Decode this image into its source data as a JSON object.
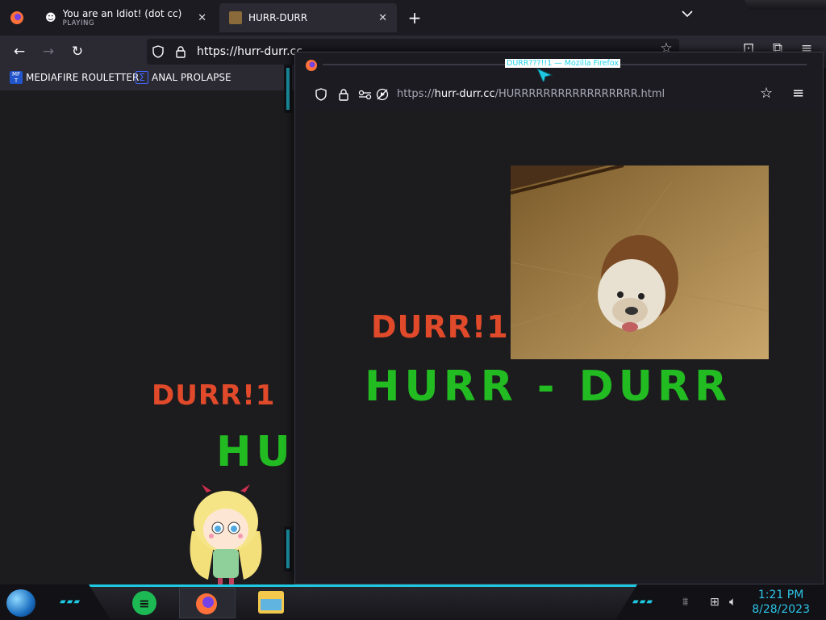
{
  "tabs": [
    {
      "title": "You are an Idiot! (dot cc)",
      "status": "PLAYING",
      "icon": "smiley-icon"
    },
    {
      "title": "HURR-DURR",
      "icon": "dog-icon"
    }
  ],
  "main_window": {
    "url": "https://hurr-durr.cc",
    "bookmarks": [
      {
        "label": "MEDIAFIRE ROULETTER",
        "icon": "mediafire-icon"
      },
      {
        "label": "ANAL PROLAPSE",
        "icon": "sigma-icon"
      }
    ],
    "page": {
      "durr": "DURR!1",
      "hurr": "HU"
    }
  },
  "popup_window": {
    "title": "DURR???!!1 — Mozilla Firefox",
    "url_prefix": "https://",
    "url_domain": "hurr-durr.cc",
    "url_path": "/HURRRRRRRRRRRRRRRRR.html",
    "page": {
      "durr": "DURR!1",
      "hurr": "HURR - DURR"
    }
  },
  "taskbar": {
    "time": "1:21 PM",
    "date": "8/28/2023"
  },
  "colors": {
    "accent": "#1ec8e0",
    "hurr": "#22bb22",
    "durr": "#e04a2a",
    "chrome": "#2b2a33"
  }
}
